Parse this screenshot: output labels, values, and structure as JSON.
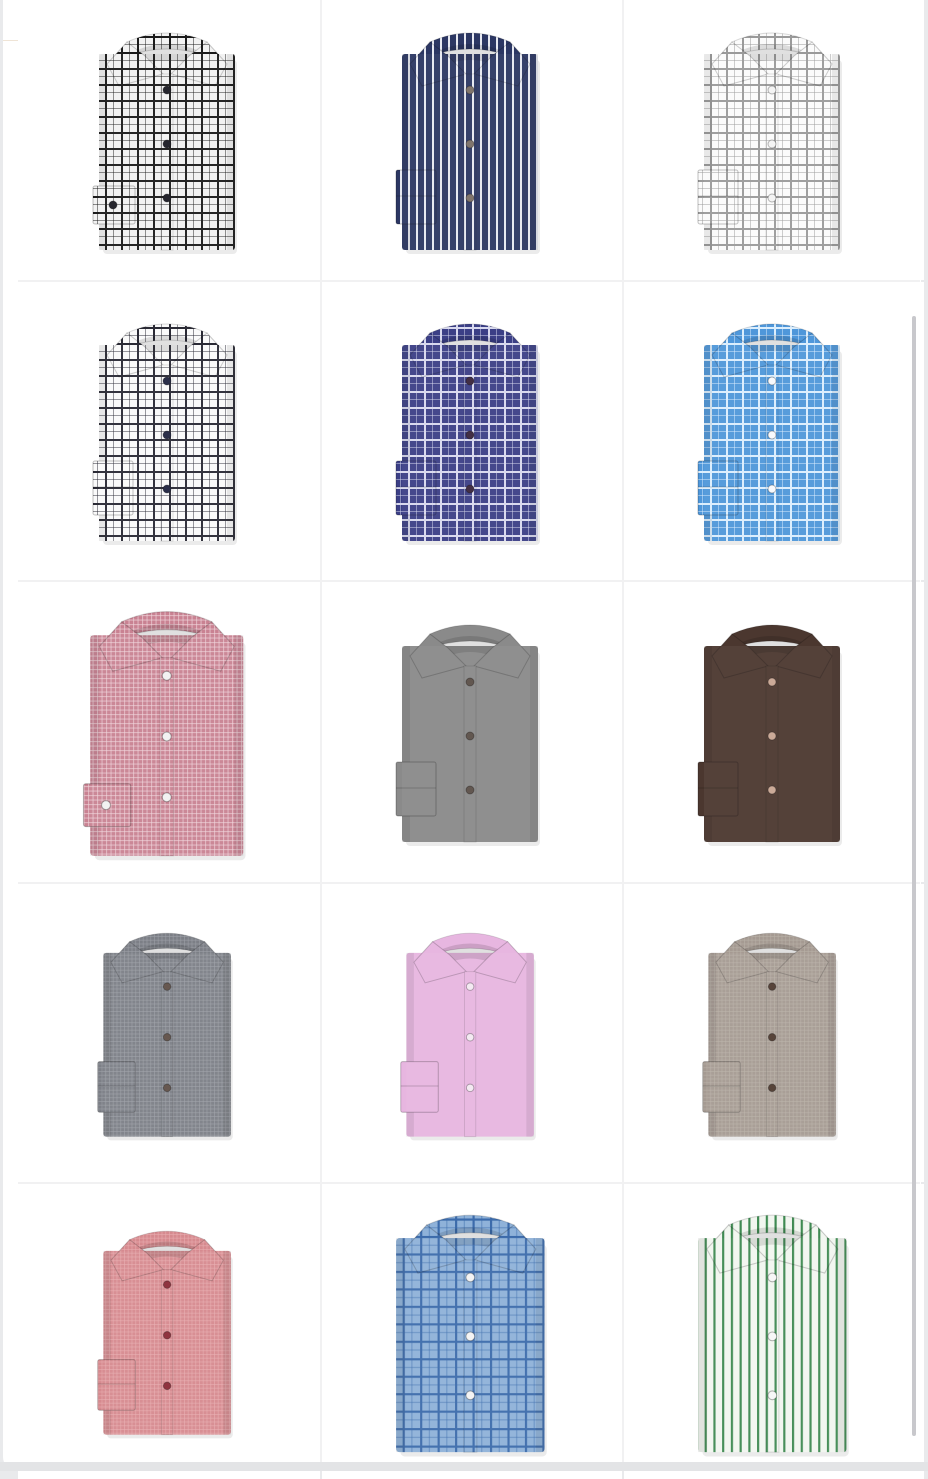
{
  "colors": {
    "background": "#ffffff",
    "grid_gap": "#f1f1f2",
    "accent_line": "#efe4d6"
  },
  "products": [
    {
      "name": "black-white-large-check-shirt",
      "icon": "shirt-icon",
      "pattern": "check",
      "base": "#f2f2f2",
      "line": "#1b1b1b",
      "button": "#1a1a22",
      "cuff": "single"
    },
    {
      "name": "navy-white-stripe-shirt",
      "icon": "shirt-icon",
      "pattern": "stripe",
      "base": "#2c3763",
      "line": "#e7e9f1",
      "button": "#7b6f66",
      "cuff": "french"
    },
    {
      "name": "white-grey-windowpane-shirt",
      "icon": "shirt-icon",
      "pattern": "check",
      "base": "#fbfbfb",
      "line": "#9a9a9a",
      "button": "#f4f4f4",
      "cuff": "french"
    },
    {
      "name": "white-black-check-shirt",
      "icon": "shirt-icon",
      "pattern": "check",
      "base": "#fafafa",
      "line": "#2a2a35",
      "button": "#1f2340",
      "cuff": "french"
    },
    {
      "name": "navy-purple-check-shirt",
      "icon": "shirt-icon",
      "pattern": "check",
      "base": "#3b3f86",
      "line": "#d8d9ef",
      "button": "#39243b",
      "cuff": "french"
    },
    {
      "name": "blue-white-check-shirt",
      "icon": "shirt-icon",
      "pattern": "check",
      "base": "#4f97da",
      "line": "#dbeefd",
      "button": "#f7f9fc",
      "cuff": "french"
    },
    {
      "name": "pink-red-mini-check-shirt",
      "icon": "shirt-icon",
      "pattern": "fine",
      "base": "#c98292",
      "line": "#f0d4da",
      "button": "#f2f2f2",
      "cuff": "single"
    },
    {
      "name": "grey-solid-shirt",
      "icon": "shirt-icon",
      "pattern": "solid",
      "base": "#8a8a8a",
      "line": "#8a8a8a",
      "button": "#5a4e47",
      "cuff": "french"
    },
    {
      "name": "brown-solid-shirt",
      "icon": "shirt-icon",
      "pattern": "solid",
      "base": "#4b372f",
      "line": "#4b372f",
      "button": "#c9a693",
      "cuff": "french"
    },
    {
      "name": "grey-oxford-shirt",
      "icon": "shirt-icon",
      "pattern": "fine",
      "base": "#7c7f86",
      "line": "#9da0a7",
      "button": "#5f5047",
      "cuff": "french"
    },
    {
      "name": "pink-lilac-shirt",
      "icon": "shirt-icon",
      "pattern": "solid",
      "base": "#e7b6e0",
      "line": "#e7b6e0",
      "button": "#f4e9f2",
      "cuff": "french"
    },
    {
      "name": "taupe-solid-shirt",
      "icon": "shirt-icon",
      "pattern": "fine",
      "base": "#a59a92",
      "line": "#b9b0a9",
      "button": "#4e3a30",
      "cuff": "french"
    },
    {
      "name": "coral-pink-shirt",
      "icon": "shirt-icon",
      "pattern": "fine",
      "base": "#d68a8f",
      "line": "#e7adb1",
      "button": "#8a2a35",
      "cuff": "french"
    },
    {
      "name": "blue-gingham-buttondown-shirt",
      "icon": "shirt-icon",
      "pattern": "check",
      "base": "#8fb2d9",
      "line": "#3c6bab",
      "button": "#f4f4f4",
      "cuff": "none"
    },
    {
      "name": "green-white-stripe-buttondown-shirt",
      "icon": "shirt-icon",
      "pattern": "stripe",
      "base": "#f2f6f0",
      "line": "#3f8a52",
      "button": "#f7f7f7",
      "cuff": "none"
    }
  ]
}
